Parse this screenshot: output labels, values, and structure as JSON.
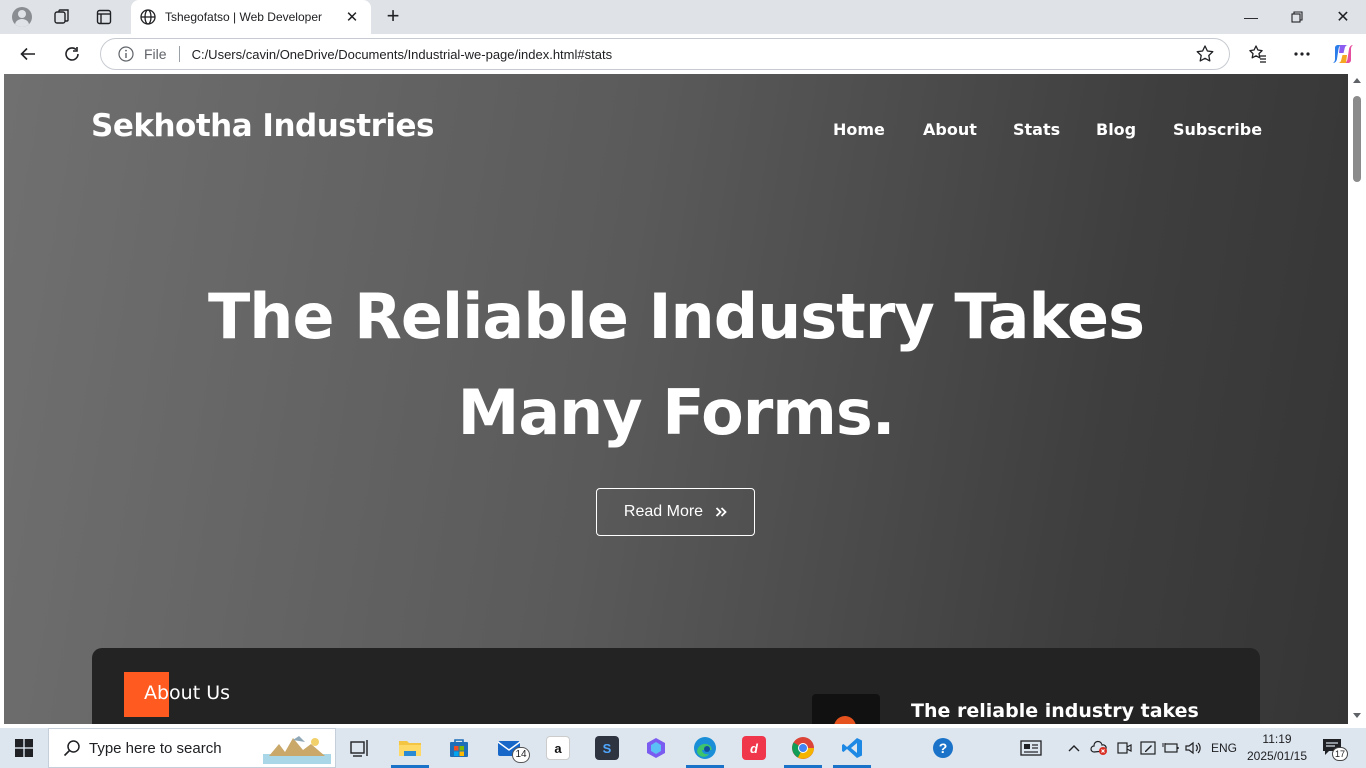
{
  "browser": {
    "tab_title": "Tshegofatso | Web Developer",
    "address_scheme": "File",
    "url": "C:/Users/cavin/OneDrive/Documents/Industrial-we-page/index.html#stats"
  },
  "site": {
    "logo": "Sekhotha Industries",
    "nav": [
      "Home",
      "About",
      "Stats",
      "Blog",
      "Subscribe"
    ],
    "hero_line1": "The Reliable Industry Takes",
    "hero_line2": "Many Forms.",
    "cta_label": "Read More",
    "about_heading": "About Us",
    "about_subheading": "The reliable industry takes",
    "colors": {
      "accent": "#ff5a1f",
      "card": "#232323",
      "hero_text": "#ffffff"
    }
  },
  "taskbar": {
    "search_placeholder": "Type here to search",
    "mail_badge": "14",
    "language": "ENG",
    "time": "11:19",
    "date": "2025/01/15",
    "notification_count": "17",
    "apps": [
      "task-view",
      "file-explorer",
      "microsoft-store",
      "mail",
      "amazon",
      "sublime",
      "copilot-app",
      "edge",
      "dj-app",
      "chrome",
      "vscode",
      "help"
    ]
  }
}
